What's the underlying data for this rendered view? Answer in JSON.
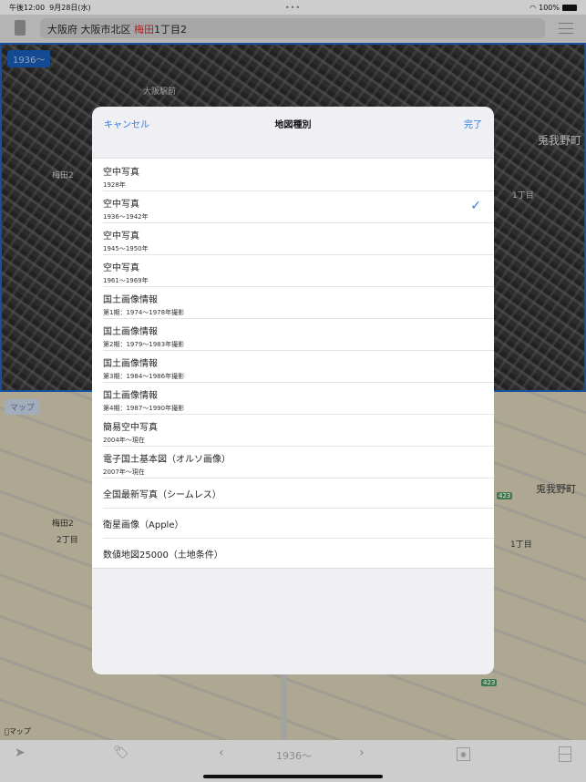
{
  "status": {
    "time": "午後12:00",
    "date": "9月28日(水)",
    "battery": "100%"
  },
  "address": {
    "prefix": "大阪府 大阪市北区 ",
    "highlight": "梅田",
    "suffix": "1丁目2",
    "highlight_color": "#c9272b"
  },
  "map": {
    "year_badge": "1936～",
    "map_badge": "マップ",
    "apple_maps": "マップ",
    "labels": [
      "大阪駅前",
      "梅田2",
      "兎我野町",
      "1丁目",
      "梅田2",
      "2丁目",
      "兎我野町",
      "1丁目",
      "423",
      "423"
    ]
  },
  "modal": {
    "cancel": "キャンセル",
    "title": "地図種別",
    "done": "完了",
    "items": [
      {
        "title": "空中写真",
        "sub": "1928年"
      },
      {
        "title": "空中写真",
        "sub": "1936～1942年",
        "selected": true
      },
      {
        "title": "空中写真",
        "sub": "1945～1950年"
      },
      {
        "title": "空中写真",
        "sub": "1961～1969年"
      },
      {
        "title": "国土画像情報",
        "sub": "第1期：1974～1978年撮影"
      },
      {
        "title": "国土画像情報",
        "sub": "第2期：1979～1983年撮影"
      },
      {
        "title": "国土画像情報",
        "sub": "第3期：1984～1986年撮影"
      },
      {
        "title": "国土画像情報",
        "sub": "第4期：1987～1990年撮影"
      },
      {
        "title": "簡易空中写真",
        "sub": "2004年～現在"
      },
      {
        "title": "電子国土基本図（オルソ画像）",
        "sub": "2007年～現在"
      },
      {
        "title": "全国最新写真（シームレス）"
      },
      {
        "title": "衛星画像（Apple）"
      },
      {
        "title": "数値地図25000（土地条件）"
      }
    ]
  },
  "toolbar": {
    "year": "1936～",
    "accent": "#2f7be0"
  }
}
